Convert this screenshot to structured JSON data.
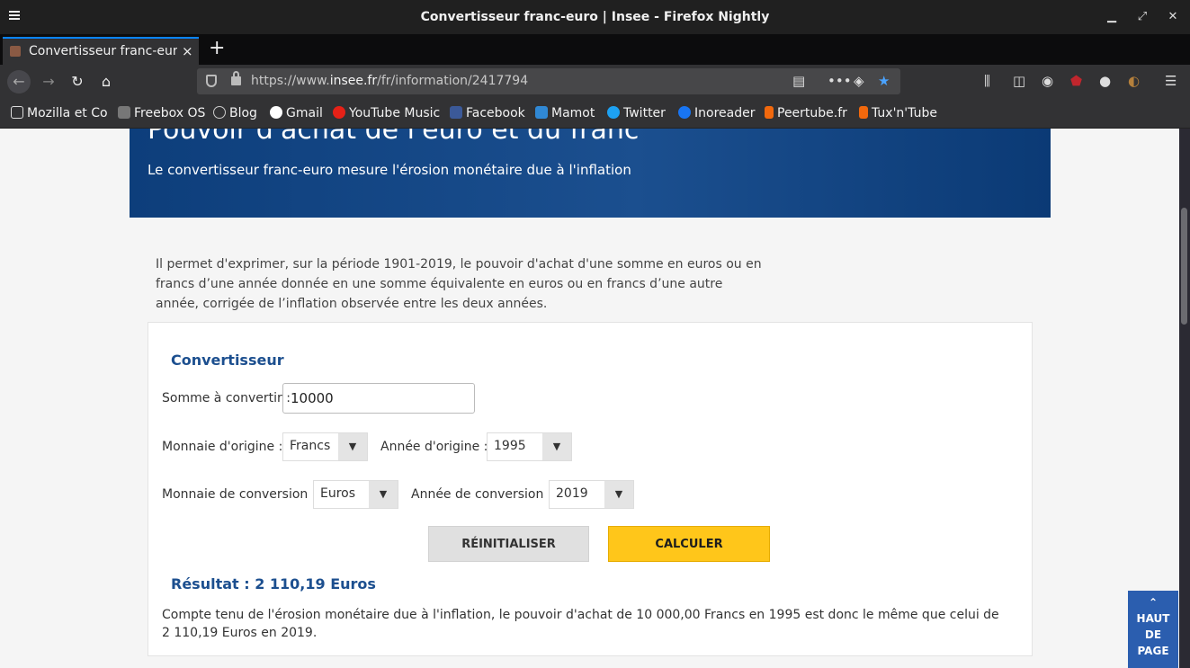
{
  "window": {
    "title": "Convertisseur franc-euro | Insee - Firefox Nightly"
  },
  "tab": {
    "label": "Convertisseur franc-euro",
    "close": "×"
  },
  "newtab": "+",
  "urlbar": {
    "prefix": "https://www.",
    "domain": "insee.fr",
    "path": "/fr/information/2417794"
  },
  "bookmarks": [
    {
      "label": "Mozilla et Co",
      "icon": "folder-icon",
      "color": "#cfcfcf"
    },
    {
      "label": "Freebox OS",
      "icon": "freebox-icon",
      "color": "#777777"
    },
    {
      "label": "Blog",
      "icon": "globe-icon",
      "color": "#bbbbbb"
    },
    {
      "label": "Gmail",
      "icon": "google-icon",
      "color": "#ffffff"
    },
    {
      "label": "YouTube Music",
      "icon": "youtube-music-icon",
      "color": "#e62117"
    },
    {
      "label": "Facebook",
      "icon": "facebook-icon",
      "color": "#3b5998"
    },
    {
      "label": "Mamot",
      "icon": "mastodon-icon",
      "color": "#3088d4"
    },
    {
      "label": "Twitter",
      "icon": "twitter-icon",
      "color": "#1da1f2"
    },
    {
      "label": "Inoreader",
      "icon": "inoreader-icon",
      "color": "#1875f3"
    },
    {
      "label": "Peertube.fr",
      "icon": "peertube-icon",
      "color": "#f1680d"
    },
    {
      "label": "Tux'n'Tube",
      "icon": "peertube-icon",
      "color": "#f1680d"
    }
  ],
  "banner": {
    "title": "Pouvoir d'achat de l'euro et du franc",
    "subtitle": "Le convertisseur franc-euro mesure l'érosion monétaire due à l'inflation"
  },
  "intro": "Il permet d'exprimer, sur la période 1901-2019, le pouvoir d'achat d'une somme en euros ou en francs d’une année donnée en une somme équivalente en euros ou en francs d’une autre année, corrigée de l’inflation observée entre les deux années.",
  "converter": {
    "title": "Convertisseur",
    "amount_label": "Somme à convertir :",
    "amount_value": "10000",
    "origin_currency_label": "Monnaie d'origine :",
    "origin_currency": "Francs",
    "origin_year_label": "Année d'origine :",
    "origin_year": "1995",
    "target_currency_label": "Monnaie de conversion :",
    "target_currency": "Euros",
    "target_year_label": "Année de conversion :",
    "target_year": "2019",
    "reset_label": "RÉINITIALISER",
    "calc_label": "CALCULER",
    "result_title": "Résultat : 2 110,19 Euros",
    "result_text": "Compte tenu de l'érosion monétaire due à l'inflation, le pouvoir d'achat de 10 000,00 Francs en 1995 est donc le même que celui de 2 110,19 Euros en 2019."
  },
  "toplink": {
    "arrow": "⌃",
    "line1": "HAUT",
    "line2": "DE",
    "line3": "PAGE"
  }
}
